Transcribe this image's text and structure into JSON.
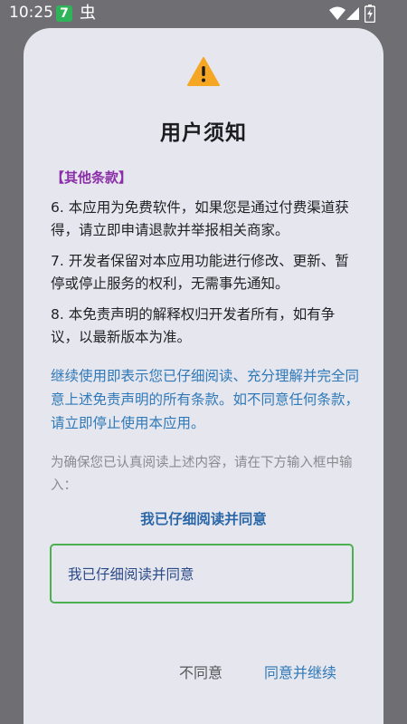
{
  "status_bar": {
    "time": "10:25",
    "app_badge": "7",
    "app_glyph": "虫"
  },
  "dialog": {
    "title": "用户须知",
    "section_heading": "【其他条款】",
    "clauses": [
      "6. 本应用为免费软件，如果您是通过付费渠道获得，请立即申请退款并举报相关商家。",
      "7. 开发者保留对本应用功能进行修改、更新、暂停或停止服务的权利，无需事先通知。",
      "8. 本免责声明的解释权归开发者所有，如有争议，以最新版本为准。"
    ],
    "notice": "继续使用即表示您已仔细阅读、充分理解并完全同意上述免责声明的所有条款。如不同意任何条款，请立即停止使用本应用。",
    "hint": "为确保您已认真阅读上述内容，请在下方输入框中输入：",
    "confirm_phrase": "我已仔细阅读并同意",
    "input_value": "我已仔细阅读并同意",
    "buttons": {
      "disagree": "不同意",
      "agree": "同意并继续"
    }
  },
  "colors": {
    "accent_blue": "#2f79b8",
    "section_purple": "#8b2fa8",
    "warning_orange": "#f5a623",
    "input_border_green": "#4caf50"
  }
}
